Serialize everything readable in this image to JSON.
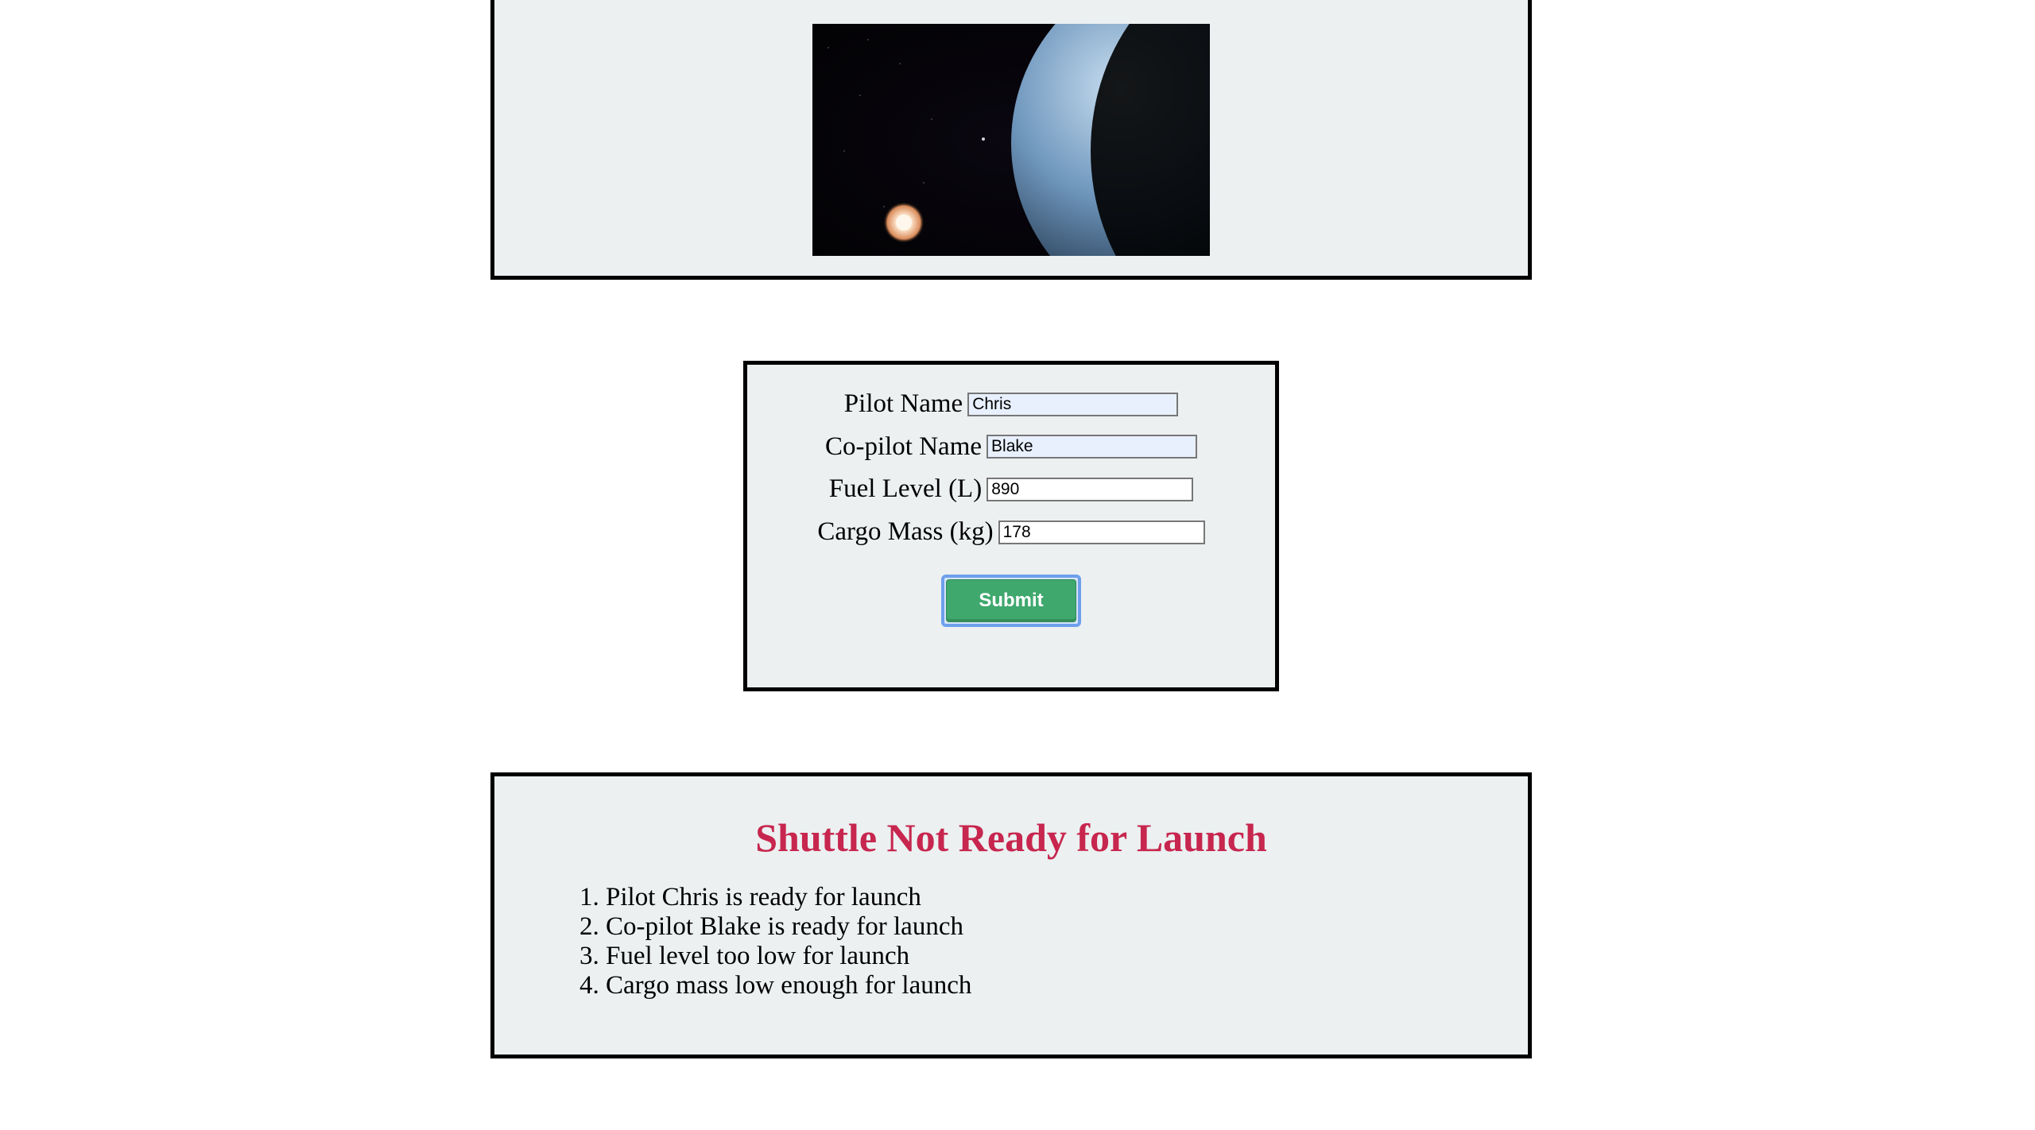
{
  "planet": {
    "alt": "planet-in-space"
  },
  "form": {
    "pilot_label": "Pilot Name",
    "pilot_value": "Chris",
    "copilot_label": "Co-pilot Name",
    "copilot_value": "Blake",
    "fuel_label": "Fuel Level (L)",
    "fuel_value": "890",
    "cargo_label": "Cargo Mass (kg)",
    "cargo_value": "178",
    "submit_label": "Submit"
  },
  "status": {
    "heading": "Shuttle Not Ready for Launch",
    "items": [
      "Pilot Chris is ready for launch",
      "Co-pilot Blake is ready for launch",
      "Fuel level too low for launch",
      "Cargo mass low enough for launch"
    ]
  }
}
